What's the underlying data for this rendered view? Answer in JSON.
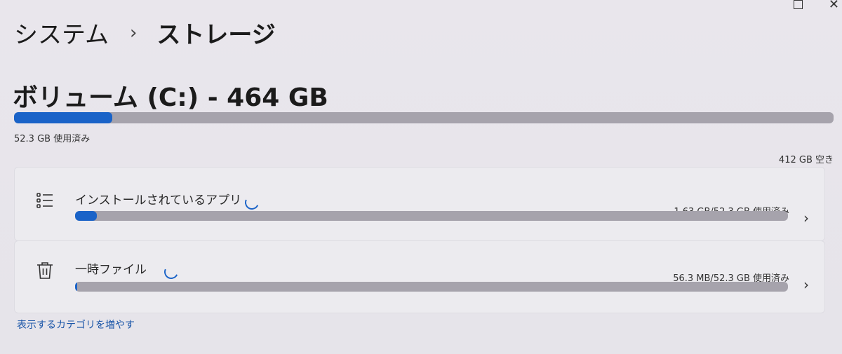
{
  "breadcrumb": {
    "parent": "システム",
    "separator": "›",
    "current": "ストレージ"
  },
  "volume": {
    "title": "ボリューム (C:) - 464 GB",
    "used_label": "52.3 GB 使用済み",
    "free_label": "412 GB 空き",
    "used_fraction": 0.12
  },
  "categories": [
    {
      "label": "インストールされているアプリ",
      "usage": "1.63 GB/52.3 GB 使用済み",
      "fraction": 0.031,
      "icon": "list-icon"
    },
    {
      "label": "一時ファイル",
      "usage": "56.3 MB/52.3 GB 使用済み",
      "fraction": 0.001,
      "icon": "trash-icon"
    }
  ],
  "more_link": "表示するカテゴリを増やす",
  "colors": {
    "accent": "#1a63c8",
    "track": "#a6a3ac"
  }
}
